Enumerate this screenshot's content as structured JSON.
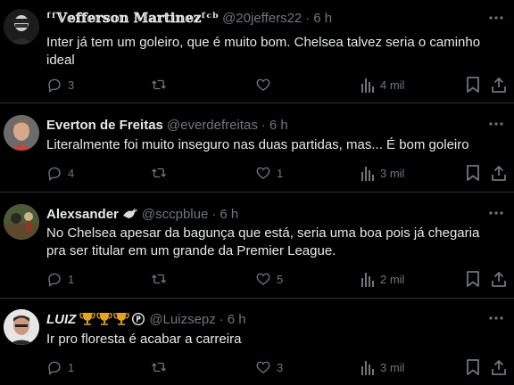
{
  "colors": {
    "background": "#000000",
    "text": "#e7e9ea",
    "muted": "#71767b",
    "divider": "#2f3336"
  },
  "tweets": [
    {
      "name": "ᶠᶠ𝕍𝕖𝕗𝕗𝕖𝕣𝕤𝕠𝕟 𝕄𝕒𝕣𝕥𝕚𝕟𝕖𝕫ᶠᶜᵇ",
      "handle": "@20jeffers22",
      "time": "6 h",
      "text": "Inter já tem um goleiro,  que é muito bom. Chelsea  talvez seria o caminho ideal",
      "replies": "3",
      "retweets": "",
      "likes": "",
      "views": "4 mil"
    },
    {
      "name": "Everton de Freitas",
      "handle": "@everdefreitas",
      "time": "6 h",
      "text": "Literalmente foi muito inseguro nas duas partidas, mas... É bom goleiro",
      "replies": "4",
      "retweets": "",
      "likes": "1",
      "views": "3 mil"
    },
    {
      "name": "Alexsander",
      "handle": "@sccpblue",
      "time": "6 h",
      "text": "No Chelsea apesar da bagunça que está, seria uma boa pois já chegaria pra ser titular em um grande da Premier League.",
      "replies": "1",
      "retweets": "",
      "likes": "5",
      "views": "2 mil"
    },
    {
      "name": "LUIZ",
      "handle": "@Luizsepz",
      "time": "6 h",
      "text": "Ir pro floresta é acabar a carreira",
      "replies": "1",
      "retweets": "",
      "likes": "3",
      "views": "3 mil"
    }
  ]
}
